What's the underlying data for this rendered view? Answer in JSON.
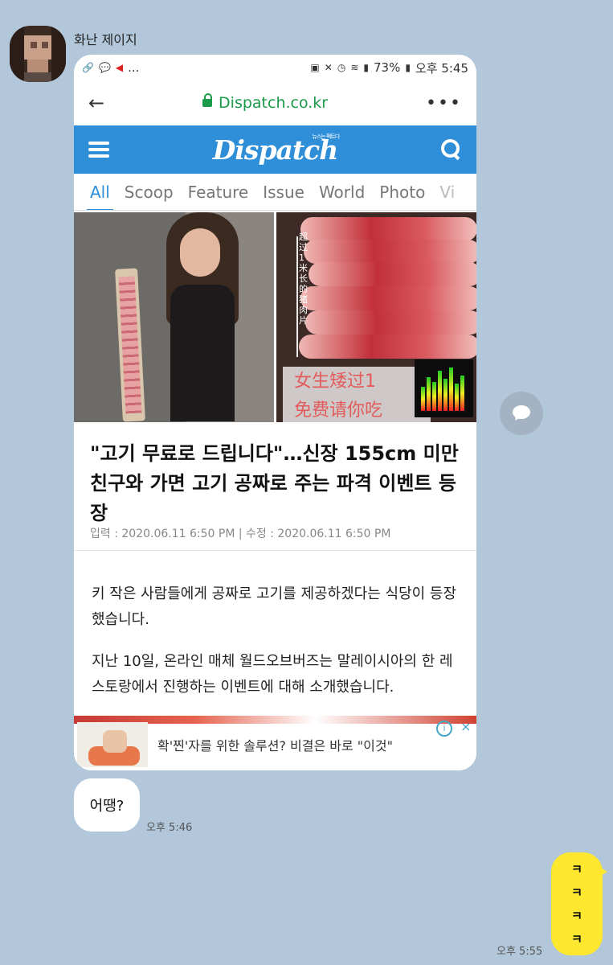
{
  "chat": {
    "sender_name": "화난 제이지",
    "shared_screenshot": {
      "status_bar": {
        "left_icons": [
          "link-icon",
          "talk-icon",
          "speaker-icon"
        ],
        "ellipsis": "...",
        "battery": "73%",
        "time": "오후 5:45"
      },
      "browser": {
        "url": "Dispatch.co.kr",
        "back_icon": "←",
        "more_icon": "•••"
      },
      "site": {
        "logo": "Dispatch",
        "logo_tag": "뉴스는 팩트다",
        "tabs": [
          "All",
          "Scoop",
          "Feature",
          "Issue",
          "World",
          "Photo",
          "Vi"
        ]
      },
      "hero": {
        "overlay_line1": "女生矮过1",
        "overlay_line2": "免费请你吃",
        "vertical_text": "超过1米长的猪肉片"
      },
      "article": {
        "title": "\"고기 무료로 드립니다\"…신장 155cm 미만 친구와 가면 고기 공짜로 주는 파격 이벤트 등장",
        "meta": "입력 : 2020.06.11 6:50 PM | 수정 : 2020.06.11 6:50 PM",
        "paragraphs": [
          "키 작은 사람들에게 공짜로 고기를 제공하겠다는 식당이 등장했습니다.",
          "지난 10일, 온라인 매체 월드오브버즈는 말레이시아의 한 레스토랑에서 진행하는 이벤트에 대해 소개했습니다."
        ]
      },
      "ad": {
        "text": "확'찐'자를 위한 솔루션? 비결은 바로 \"이것\"",
        "info_icon": "i",
        "close_icon": "×"
      }
    },
    "received_message": {
      "text": "어땡?",
      "time": "오후 5:46"
    },
    "sent_message": {
      "lines": [
        "ㅋ",
        "ㅋ",
        "ㅋ",
        "ㅋ"
      ],
      "time": "오후 5:55"
    }
  },
  "colors": {
    "chat_background": "#b2c7da",
    "dispatch_blue": "#2e8fd8",
    "sent_bubble": "#fee82f",
    "url_green": "#1a9a4a"
  }
}
